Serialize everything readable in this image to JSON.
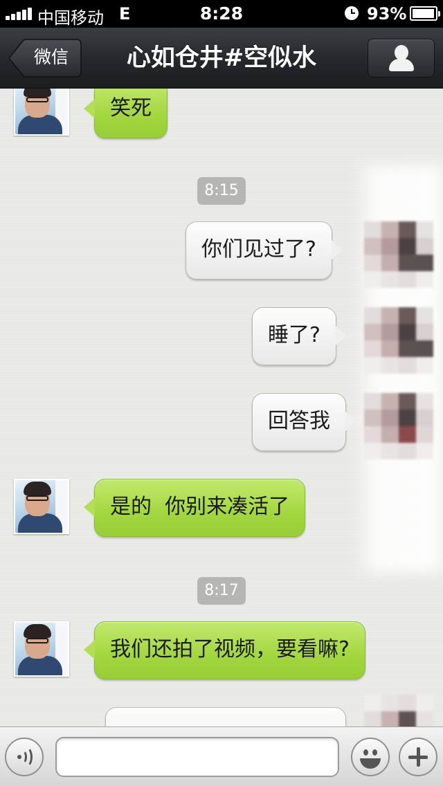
{
  "status_bar": {
    "carrier": "中国移动",
    "network": "E",
    "time": "8:28",
    "battery": "93%"
  },
  "nav": {
    "back_label": "微信",
    "title": "心如仓井#空似水"
  },
  "messages": [
    {
      "side": "left",
      "text": "笑死"
    },
    {
      "timestamp": "8:15"
    },
    {
      "side": "right",
      "text": "你们见过了?"
    },
    {
      "side": "right",
      "text": "睡了?"
    },
    {
      "side": "right",
      "text": "回答我"
    },
    {
      "side": "left",
      "text": "是的  你别来凑活了"
    },
    {
      "timestamp": "8:17"
    },
    {
      "side": "left",
      "text": "我们还拍了视频，要看嘛?"
    },
    {
      "side": "right",
      "text": ""
    }
  ],
  "input": {
    "value": "",
    "placeholder": ""
  },
  "icons": {
    "voice": "voice-icon",
    "emoji": "emoji-icon",
    "plus": "plus-icon",
    "profile": "profile-icon"
  },
  "colors": {
    "incoming_bubble": "#a3d63f",
    "outgoing_bubble": "#f0f0f0",
    "nav_bar": "#24272b"
  }
}
